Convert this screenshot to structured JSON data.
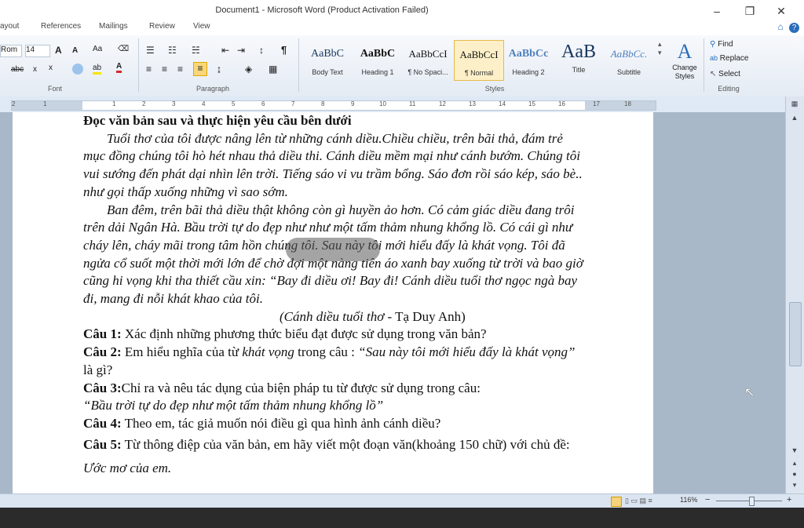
{
  "window": {
    "title": "Document1 - Microsoft Word (Product Activation Failed)",
    "minimize": "–",
    "restore": "❐",
    "close": "✕"
  },
  "tabs": [
    "ayout",
    "References",
    "Mailings",
    "Review",
    "View"
  ],
  "tab_icons": {
    "help": "?",
    "collapse": "⌂"
  },
  "ribbon": {
    "font_name": "Rom",
    "font_size": "14",
    "grow": "A",
    "shrink": "A",
    "change_case": "Aa",
    "clear": "⌫",
    "strike": "abc",
    "subscript": "x",
    "superscript": "x",
    "font_color": "A",
    "highlight": "ab",
    "groups": {
      "font": "Font",
      "paragraph": "Paragraph",
      "styles": "Styles",
      "editing": "Editing"
    },
    "styles": [
      {
        "preview": "AaBbC",
        "name": "Body Text"
      },
      {
        "preview": "AaBbC",
        "name": "Heading 1"
      },
      {
        "preview": "AaBbCcI",
        "name": "¶ No Spaci..."
      },
      {
        "preview": "AaBbCcI",
        "name": "¶ Normal"
      },
      {
        "preview": "AaBbCc",
        "name": "Heading 2"
      },
      {
        "preview": "AaB",
        "name": "Title"
      },
      {
        "preview": "AaBbCc.",
        "name": "Subtitle"
      }
    ],
    "change_styles": "Change Styles",
    "find": "Find",
    "replace": "Replace",
    "select": "Select"
  },
  "ruler": {
    "numbers": [
      "2",
      "1",
      "1",
      "2",
      "3",
      "4",
      "5",
      "6",
      "7",
      "8",
      "9",
      "10",
      "11",
      "12",
      "13",
      "14",
      "15",
      "16",
      "17",
      "18"
    ]
  },
  "document": {
    "heading": "Đọc văn bản sau và thực hiện yêu cầu bên dưới",
    "para1": "Tuổi thơ của tôi được nâng lên từ những cánh diều.Chiều chiều, trên bãi thả, đám trẻ mục đồng chúng tôi hò hét nhau thả diều thi. Cánh diều mềm mại như cánh bướm. Chúng tôi vui sướng đến phát dại nhìn lên trời. Tiếng sáo vi vu trầm bổng. Sáo đơn rồi sáo kép, sáo bè.. như gọi thấp xuống những vì sao sớm.",
    "para2": "Ban đêm, trên bãi thả diều thật không còn gì huyền ảo hơn. Có cảm giác diều đang trôi trên dải Ngân Hà. Bầu trời tự do đẹp như như một tấm thảm nhung khổng lồ. Có cái gì như cháy lên, cháy mãi trong tâm hồn chúng tôi. Sau này tôi mới hiểu đấy là khát vọng. Tôi đã ngửa cổ suốt một thời mới lớn để chờ đợi một nàng tiên áo xanh bay xuống từ trời và bao giờ cũng hi vọng khi tha thiết cầu xin: “Bay đi diều ơi! Bay đi! Cánh diều tuổi thơ ngọc ngà bay đi, mang đi nỗi khát khao của tôi.",
    "source_title": "(Cánh diều tuổi thơ",
    "source_author": " - Tạ Duy Anh)",
    "q1_label": "Câu 1:",
    "q1_text": "  Xác định những phương thức biểu đạt được sử dụng trong văn bản?",
    "q2_label": "Câu 2:",
    "q2_text_a": " Em hiểu nghĩa của từ ",
    "q2_italic": "khát vọng",
    "q2_text_b": " trong câu : ",
    "q2_quote": "“Sau này tôi mới hiểu đấy là khát vọng”",
    "q2_text_c": " là gì?",
    "q3_label": "Câu 3:",
    "q3_text": "Chỉ ra và nêu tác dụng của biện pháp tu từ được sử dụng trong câu:",
    "q3_quote": "“Bầu trời tự do đẹp như một tấm thảm nhung khổng lồ”",
    "q4_label": "Câu 4:",
    "q4_text": " Theo em, tác giả muốn nói điều gì qua hình ảnh cánh diều?",
    "q5_label": "Câu 5:",
    "q5_text": " Từ thông điệp của văn bản, em hãy viết một đoạn văn(khoảng 150 chữ) với chủ đề: ",
    "q5_topic": "Ước mơ của em."
  },
  "status": {
    "zoom": "116%",
    "zoom_out": "−",
    "zoom_in": "+"
  }
}
